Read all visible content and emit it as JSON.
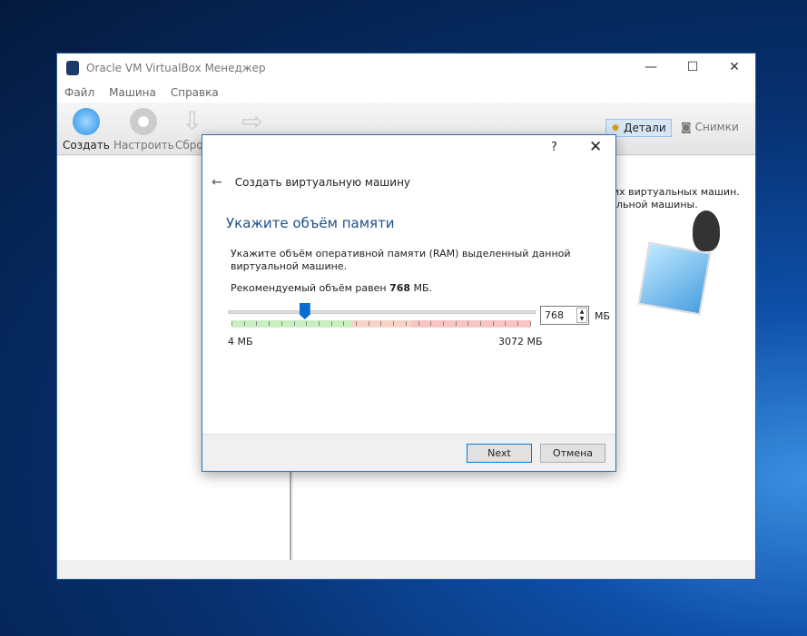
{
  "window": {
    "title": "Oracle VM VirtualBox Менеджер",
    "minimize": "—",
    "maximize": "☐",
    "close": "✕"
  },
  "menu": [
    "Файл",
    "Машина",
    "Справка"
  ],
  "toolbar": {
    "create": "Создать",
    "settings": "Настроить",
    "discard": "Сброс"
  },
  "segments": {
    "details": "Детали",
    "snapshots": "Снимки"
  },
  "welcome": {
    "line1": "их виртуальных машин.",
    "line2": "льной машины."
  },
  "dialog": {
    "help": "?",
    "close": "✕",
    "back": "←",
    "header": "Создать виртуальную машину",
    "heading": "Укажите объём памяти",
    "description": "Укажите объём оперативной памяти (RAM) выделенный данной виртуальной машине.",
    "rec_prefix": "Рекомендуемый объём равен",
    "rec_value": "768",
    "rec_suffix": "МБ.",
    "memory": {
      "value": "768",
      "unit": "МБ",
      "min_label": "4 МБ",
      "max_label": "3072 МБ",
      "fraction": 0.25
    },
    "next": "Next",
    "cancel": "Отмена"
  }
}
